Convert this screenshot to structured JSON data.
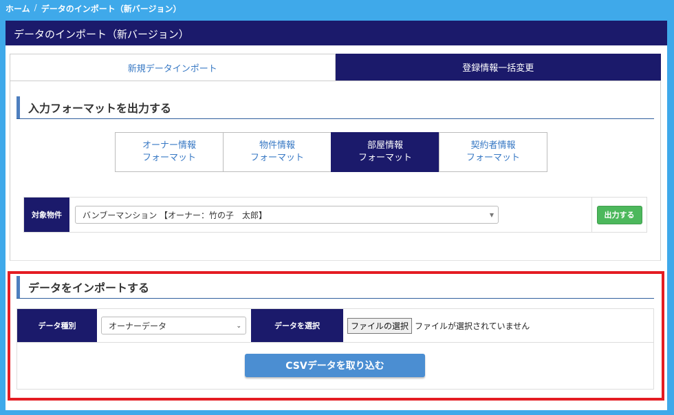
{
  "breadcrumb": {
    "home": "ホーム",
    "separator": "/",
    "current": "データのインポート（新バージョン）"
  },
  "panel": {
    "title": "データのインポート（新バージョン）"
  },
  "tabs": [
    {
      "label": "新規データインポート",
      "active": false
    },
    {
      "label": "登録情報一括変更",
      "active": true
    }
  ],
  "export_section": {
    "title": "入力フォーマットを出力する",
    "formats": [
      {
        "line1": "オーナー情報",
        "line2": "フォーマット",
        "active": false
      },
      {
        "line1": "物件情報",
        "line2": "フォーマット",
        "active": false
      },
      {
        "line1": "部屋情報",
        "line2": "フォーマット",
        "active": true
      },
      {
        "line1": "契約者情報",
        "line2": "フォーマット",
        "active": false
      }
    ],
    "target_label": "対象物件",
    "target_value": "バンブーマンション 【オーナー：竹の子　太郎】",
    "output_button": "出力する"
  },
  "import_section": {
    "title": "データをインポートする",
    "type_label": "データ種別",
    "type_value": "オーナーデータ",
    "select_label": "データを選択",
    "file_button": "ファイルの選択",
    "file_status": "ファイルが選択されていません",
    "csv_button": "CSVデータを取り込む"
  },
  "colors": {
    "navy": "#1b1a6b",
    "accent_blue": "#3fa9ea",
    "green": "#4cb85c",
    "highlight_red": "#e41c23"
  }
}
